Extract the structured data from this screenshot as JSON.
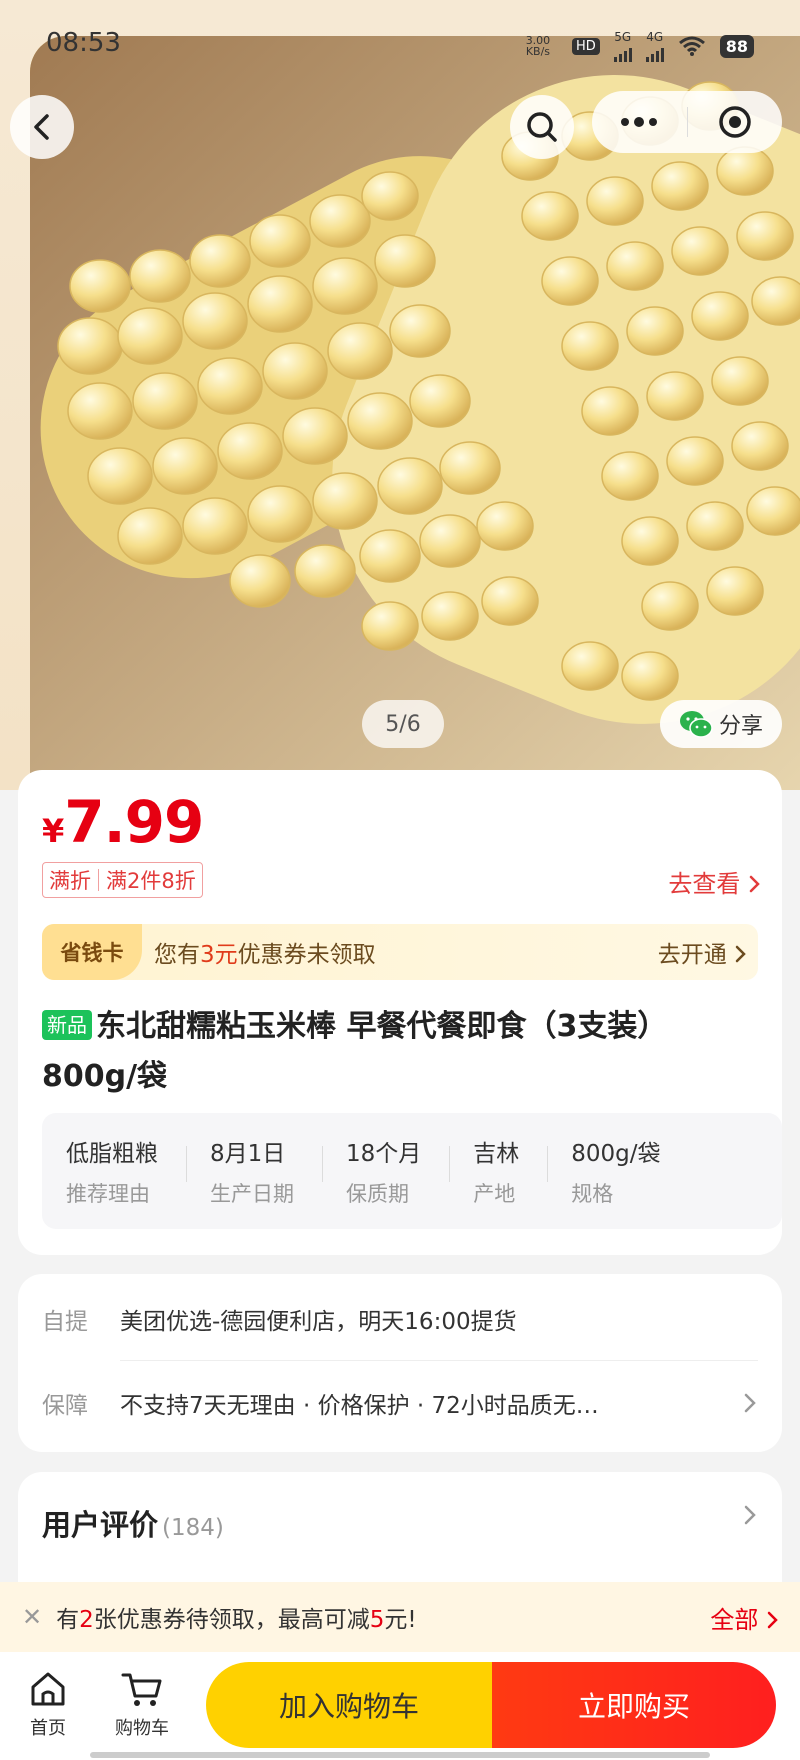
{
  "status": {
    "time": "08:53",
    "net_speed": "3.00 KB/s",
    "hd_label": "HD",
    "net_5g": "5G",
    "net_4g": "4G",
    "battery": "88"
  },
  "gallery": {
    "page_indicator": "5/6",
    "share_label": "分享"
  },
  "product": {
    "currency": "¥",
    "price": "7.99",
    "promo_type": "满折",
    "promo_detail": "满2件8折",
    "see_more": "去查看",
    "save_card": {
      "badge": "省钱卡",
      "text_prefix": "您有",
      "text_highlight": "3元",
      "text_suffix": "优惠券未领取",
      "action": "去开通"
    },
    "new_badge": "新品",
    "title": "东北甜糯粘玉米棒 早餐代餐即食（3支装）800g/袋",
    "attributes": [
      {
        "value": "低脂粗粮",
        "key": "推荐理由"
      },
      {
        "value": "8月1日",
        "key": "生产日期"
      },
      {
        "value": "18个月",
        "key": "保质期"
      },
      {
        "value": "吉林",
        "key": "产地"
      },
      {
        "value": "800g/袋",
        "key": "规格"
      }
    ]
  },
  "pickup": {
    "label": "自提",
    "value": "美团优选-德园便利店，明天16:00提货"
  },
  "guarantee": {
    "label": "保障",
    "value": "不支持7天无理由 · 价格保护 · 72小时品质无…"
  },
  "reviews": {
    "title": "用户评价",
    "count": "(184)"
  },
  "coupon_bar": {
    "text_1": "有",
    "num_1": "2",
    "text_2": "张优惠券待领取，最高可减",
    "num_2": "5",
    "text_3": "元!",
    "all": "全部"
  },
  "bottom_nav": {
    "home": "首页",
    "cart": "购物车",
    "add_to_cart": "加入购物车",
    "buy_now": "立即购买"
  },
  "colors": {
    "price_red": "#e60012",
    "cart_yellow": "#ffd100",
    "buy_red": "#ff2a1a",
    "new_green": "#1cc25a"
  }
}
